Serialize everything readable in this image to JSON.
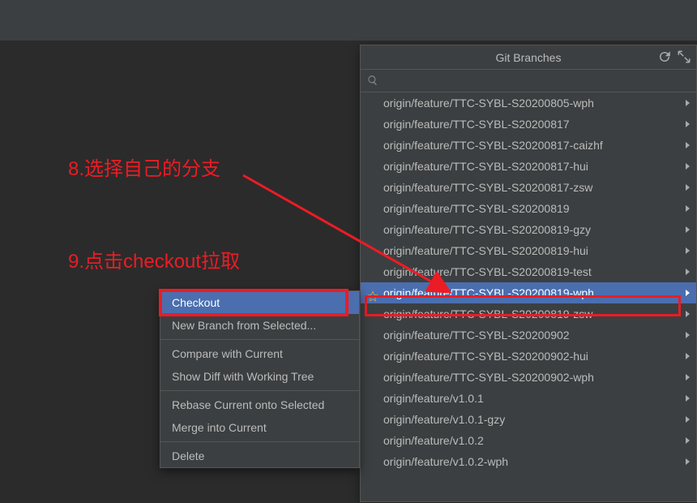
{
  "popup": {
    "title": "Git Branches",
    "search_placeholder": ""
  },
  "branches": [
    {
      "label": "origin/feature/TTC-SYBL-S20200805-wph",
      "selected": false,
      "star": false
    },
    {
      "label": "origin/feature/TTC-SYBL-S20200817",
      "selected": false,
      "star": false
    },
    {
      "label": "origin/feature/TTC-SYBL-S20200817-caizhf",
      "selected": false,
      "star": false
    },
    {
      "label": "origin/feature/TTC-SYBL-S20200817-hui",
      "selected": false,
      "star": false
    },
    {
      "label": "origin/feature/TTC-SYBL-S20200817-zsw",
      "selected": false,
      "star": false
    },
    {
      "label": "origin/feature/TTC-SYBL-S20200819",
      "selected": false,
      "star": false
    },
    {
      "label": "origin/feature/TTC-SYBL-S20200819-gzy",
      "selected": false,
      "star": false
    },
    {
      "label": "origin/feature/TTC-SYBL-S20200819-hui",
      "selected": false,
      "star": false
    },
    {
      "label": "origin/feature/TTC-SYBL-S20200819-test",
      "selected": false,
      "star": false
    },
    {
      "label": "origin/feature/TTC-SYBL-S20200819-wph",
      "selected": true,
      "star": true
    },
    {
      "label": "origin/feature/TTC-SYBL-S20200819-zsw",
      "selected": false,
      "star": false
    },
    {
      "label": "origin/feature/TTC-SYBL-S20200902",
      "selected": false,
      "star": false
    },
    {
      "label": "origin/feature/TTC-SYBL-S20200902-hui",
      "selected": false,
      "star": false
    },
    {
      "label": "origin/feature/TTC-SYBL-S20200902-wph",
      "selected": false,
      "star": false
    },
    {
      "label": "origin/feature/v1.0.1",
      "selected": false,
      "star": false
    },
    {
      "label": "origin/feature/v1.0.1-gzy",
      "selected": false,
      "star": false
    },
    {
      "label": "origin/feature/v1.0.2",
      "selected": false,
      "star": false
    },
    {
      "label": "origin/feature/v1.0.2-wph",
      "selected": false,
      "star": false
    }
  ],
  "context_menu": [
    {
      "label": "Checkout",
      "selected": true
    },
    {
      "label": "New Branch from Selected...",
      "selected": false
    },
    {
      "sep": true
    },
    {
      "label": "Compare with Current",
      "selected": false
    },
    {
      "label": "Show Diff with Working Tree",
      "selected": false
    },
    {
      "sep": true
    },
    {
      "label": "Rebase Current onto Selected",
      "selected": false
    },
    {
      "label": "Merge into Current",
      "selected": false
    },
    {
      "sep": true
    },
    {
      "label": "Delete",
      "selected": false
    }
  ],
  "annotations": {
    "step8": "8.选择自己的分支",
    "step9": "9.点击checkout拉取"
  },
  "colors": {
    "annotation_red": "#ec1c24",
    "selection_blue": "#4b6eaf",
    "popup_bg": "#3c3f41",
    "editor_bg": "#2b2b2b"
  }
}
